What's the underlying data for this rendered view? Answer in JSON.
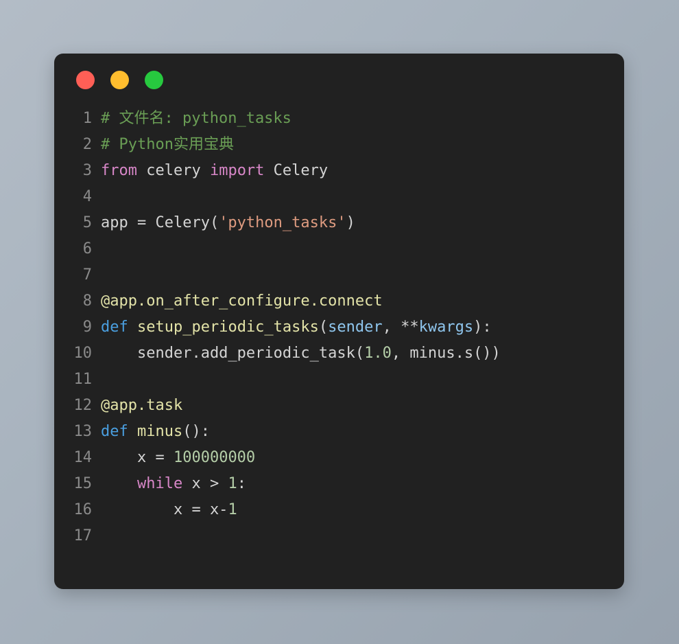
{
  "window": {
    "controls": [
      {
        "name": "close",
        "color": "#ff5f56"
      },
      {
        "name": "minimize",
        "color": "#ffbd2e"
      },
      {
        "name": "maximize",
        "color": "#27c93f"
      }
    ]
  },
  "editor": {
    "background": "#212121",
    "default_text_color": "#d4d4d4",
    "line_number_color": "#8a8a8a",
    "language": "python",
    "first_line_number": 1,
    "last_line_number": 17,
    "lines": [
      {
        "num": "1",
        "tokens": [
          {
            "t": "# 文件名: python_tasks",
            "c": "t-com"
          }
        ]
      },
      {
        "num": "2",
        "tokens": [
          {
            "t": "# Python实用宝典",
            "c": "t-com"
          }
        ]
      },
      {
        "num": "3",
        "tokens": [
          {
            "t": "from",
            "c": "t-kw"
          },
          {
            "t": " celery ",
            "c": "t-pln"
          },
          {
            "t": "import",
            "c": "t-kw"
          },
          {
            "t": " Celery",
            "c": "t-pln"
          }
        ]
      },
      {
        "num": "4",
        "tokens": []
      },
      {
        "num": "5",
        "tokens": [
          {
            "t": "app = Celery(",
            "c": "t-pln"
          },
          {
            "t": "'python_tasks'",
            "c": "t-str"
          },
          {
            "t": ")",
            "c": "t-pln"
          }
        ]
      },
      {
        "num": "6",
        "tokens": []
      },
      {
        "num": "7",
        "tokens": []
      },
      {
        "num": "8",
        "tokens": [
          {
            "t": "@app.on_after_configure.connect",
            "c": "t-dec"
          }
        ]
      },
      {
        "num": "9",
        "tokens": [
          {
            "t": "def",
            "c": "t-def"
          },
          {
            "t": " ",
            "c": "t-pln"
          },
          {
            "t": "setup_periodic_tasks",
            "c": "t-fn"
          },
          {
            "t": "(",
            "c": "t-pln"
          },
          {
            "t": "sender",
            "c": "t-par"
          },
          {
            "t": ", **",
            "c": "t-pln"
          },
          {
            "t": "kwargs",
            "c": "t-par"
          },
          {
            "t": "):",
            "c": "t-pln"
          }
        ]
      },
      {
        "num": "10",
        "tokens": [
          {
            "t": "    sender.add_periodic_task(",
            "c": "t-pln"
          },
          {
            "t": "1.0",
            "c": "t-num"
          },
          {
            "t": ", minus.s())",
            "c": "t-pln"
          }
        ]
      },
      {
        "num": "11",
        "tokens": []
      },
      {
        "num": "12",
        "tokens": [
          {
            "t": "@app.task",
            "c": "t-dec"
          }
        ]
      },
      {
        "num": "13",
        "tokens": [
          {
            "t": "def",
            "c": "t-def"
          },
          {
            "t": " ",
            "c": "t-pln"
          },
          {
            "t": "minus",
            "c": "t-fn"
          },
          {
            "t": "():",
            "c": "t-pln"
          }
        ]
      },
      {
        "num": "14",
        "tokens": [
          {
            "t": "    x = ",
            "c": "t-pln"
          },
          {
            "t": "100000000",
            "c": "t-num"
          }
        ]
      },
      {
        "num": "15",
        "tokens": [
          {
            "t": "    ",
            "c": "t-pln"
          },
          {
            "t": "while",
            "c": "t-kw"
          },
          {
            "t": " x > ",
            "c": "t-pln"
          },
          {
            "t": "1",
            "c": "t-num"
          },
          {
            "t": ":",
            "c": "t-pln"
          }
        ]
      },
      {
        "num": "16",
        "tokens": [
          {
            "t": "        x = x-",
            "c": "t-pln"
          },
          {
            "t": "1",
            "c": "t-num"
          }
        ]
      },
      {
        "num": "17",
        "tokens": []
      }
    ]
  }
}
